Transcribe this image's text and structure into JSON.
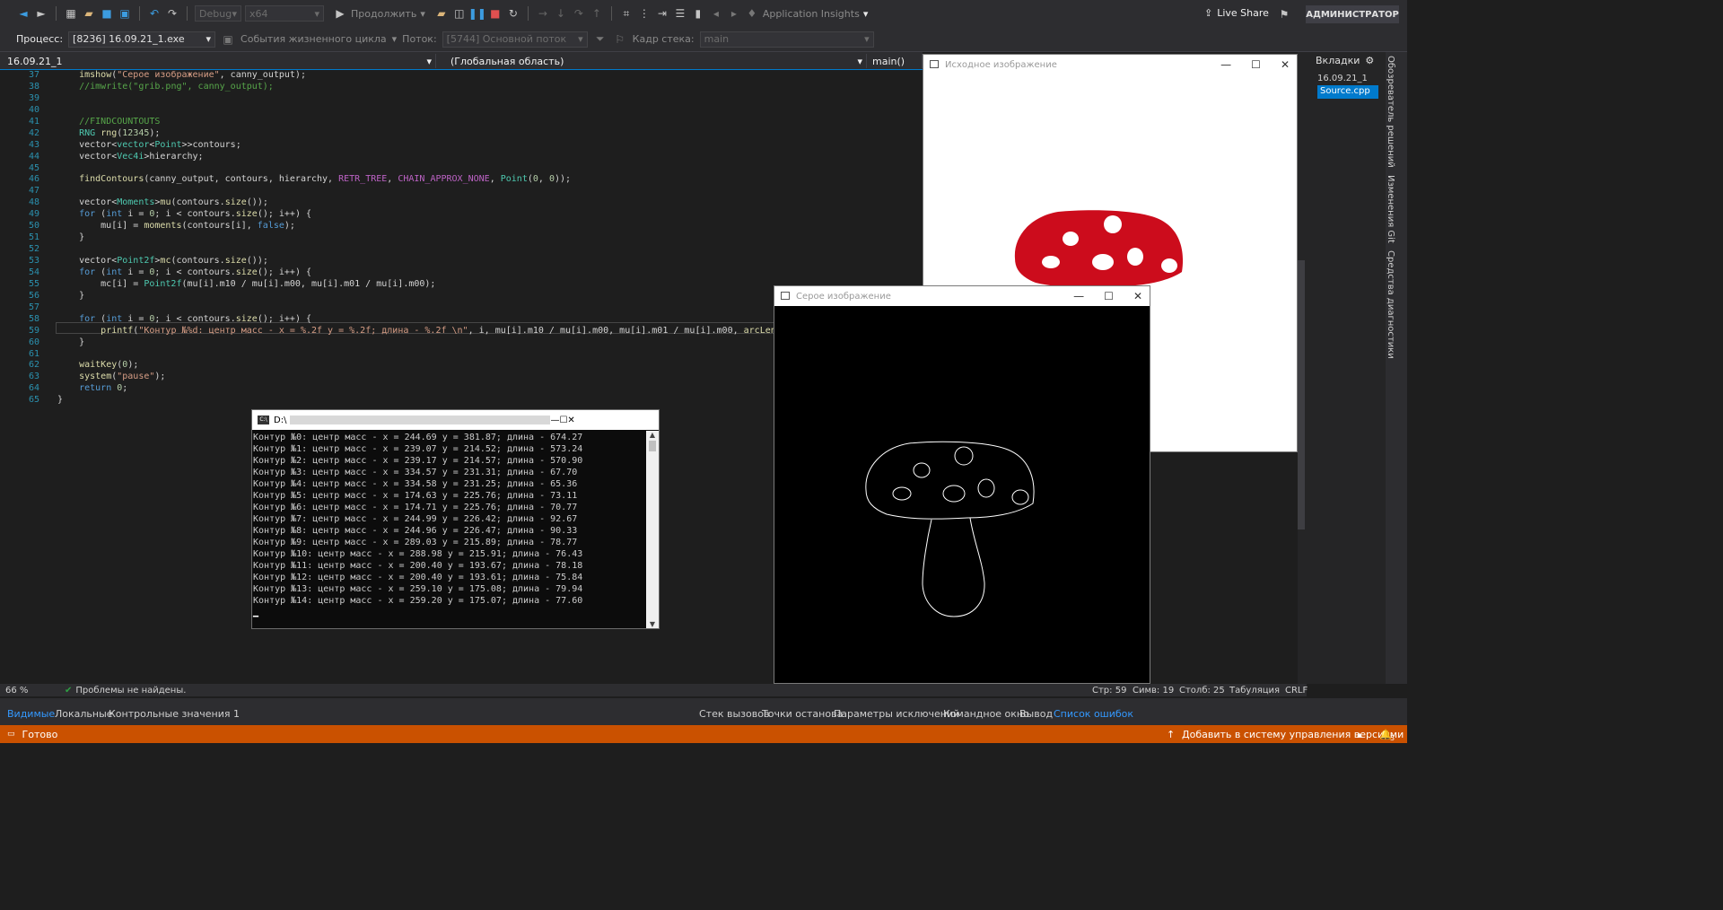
{
  "toolbar": {
    "config": "Debug",
    "platform": "x64",
    "continue_label": "Продолжить",
    "insights_label": "Application Insights",
    "live_share": "Live Share",
    "user": "АДМИНИСТРАТОР"
  },
  "toolbar2": {
    "process_label": "Процесс:",
    "process_value": "[8236] 16.09.21_1.exe",
    "lifecycle_label": "События жизненного цикла",
    "thread_label": "Поток:",
    "thread_value": "[5744] Основной поток",
    "stack_label": "Кадр стека:",
    "stack_value": "main"
  },
  "editor": {
    "project": "16.09.21_1",
    "scope": "(Глобальная область)",
    "function": "main()",
    "line_numbers": [
      "37",
      "38",
      "39",
      "40",
      "41",
      "42",
      "43",
      "44",
      "45",
      "46",
      "47",
      "48",
      "49",
      "50",
      "51",
      "52",
      "53",
      "54",
      "55",
      "56",
      "57",
      "58",
      "59",
      "60",
      "61",
      "62",
      "63",
      "64",
      "65"
    ]
  },
  "right_panel": {
    "title": "Вкладки",
    "project": "16.09.21_1",
    "file": "Source.cpp",
    "vtabs": [
      "Обозреватель решений",
      "Изменения Git",
      "Средства диагностики"
    ]
  },
  "windows": {
    "source_title": "Исходное изображение",
    "gray_title": "Серое изображение",
    "console_title": "D:\\"
  },
  "console_lines": [
    "Контур №0: центр масс - x = 244.69 y = 381.87; длина - 674.27",
    "Контур №1: центр масс - x = 239.07 y = 214.52; длина - 573.24",
    "Контур №2: центр масс - x = 239.17 y = 214.57; длина - 570.90",
    "Контур №3: центр масс - x = 334.57 y = 231.31; длина - 67.70",
    "Контур №4: центр масс - x = 334.58 y = 231.25; длина - 65.36",
    "Контур №5: центр масс - x = 174.63 y = 225.76; длина - 73.11",
    "Контур №6: центр масс - x = 174.71 y = 225.76; длина - 70.77",
    "Контур №7: центр масс - x = 244.99 y = 226.42; длина - 92.67",
    "Контур №8: центр масс - x = 244.96 y = 226.47; длина - 90.33",
    "Контур №9: центр масс - x = 289.03 y = 215.89; длина - 78.77",
    "Контур №10: центр масс - x = 288.98 y = 215.91; длина - 76.43",
    "Контур №11: центр масс - x = 200.40 y = 193.67; длина - 78.18",
    "Контур №12: центр масс - x = 200.40 y = 193.61; длина - 75.84",
    "Контур №13: центр масс - x = 259.10 y = 175.08; длина - 79.94",
    "Контур №14: центр масс - x = 259.20 y = 175.07; длина - 77.60"
  ],
  "status": {
    "zoom": "66 %",
    "problems": "Проблемы не найдены.",
    "line": "Стр: 59",
    "char": "Симв: 19",
    "col": "Столб: 25",
    "indent": "Табуляция",
    "eol": "CRLF"
  },
  "bottom_tabs_left": [
    "Видимые",
    "Локальные",
    "Контрольные значения 1"
  ],
  "bottom_tabs_right": [
    "Стек вызовов",
    "Точки останова",
    "Параметры исключений",
    "Командное окно",
    "Вывод",
    "Список ошибок"
  ],
  "statusbar": {
    "ready": "Готово",
    "vcs": "Добавить в систему управления версиями",
    "notif_count": "3"
  },
  "colors": {
    "accent": "#007acc",
    "status_bg": "#ca5100",
    "mushroom_red": "#cc0c1c"
  }
}
